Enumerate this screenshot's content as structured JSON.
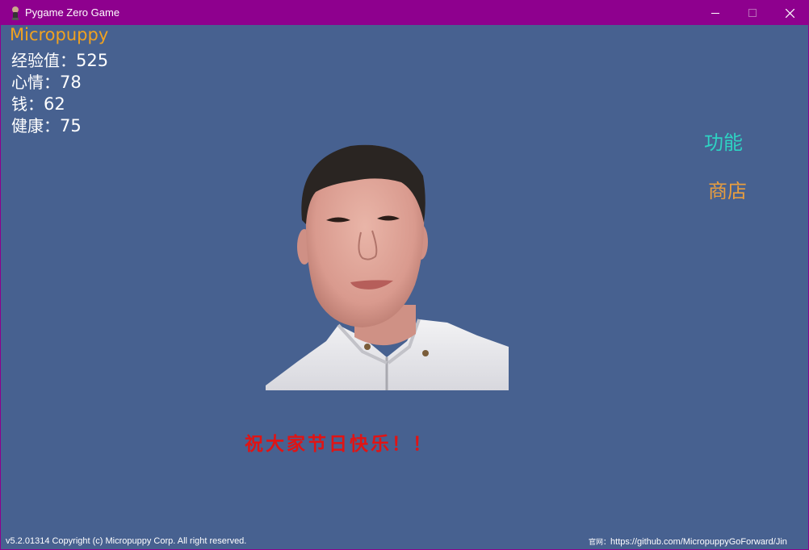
{
  "window": {
    "title": "Pygame Zero Game",
    "icon": "pygame-zero-icon",
    "controls": [
      "minimize-icon",
      "maximize-icon",
      "close-icon"
    ]
  },
  "hud": {
    "name": "Micropuppy",
    "stats": [
      {
        "label": "经验值：",
        "value": "525"
      },
      {
        "label": "心情：",
        "value": "78"
      },
      {
        "label": "钱：",
        "value": "62"
      },
      {
        "label": "健康：",
        "value": "75"
      }
    ]
  },
  "menu": {
    "function_label": "功能",
    "shop_label": "商店"
  },
  "greeting": "祝大家节日快乐！！",
  "footer": {
    "copyright": "v5.2.01314 Copyright (c) Micropuppy Corp. All right reserved.",
    "site_label": "官网：",
    "site_url": "https://github.com/MicropuppyGoForward/Jin"
  },
  "colors": {
    "titlebar": "#8e008e",
    "background": "#476190",
    "name": "#f0a220",
    "function": "#2ed3c3",
    "shop": "#e99e3e",
    "greeting": "#e01414"
  }
}
